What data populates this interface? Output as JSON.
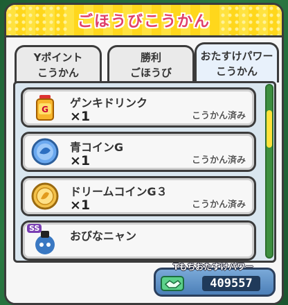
{
  "header": {
    "title": "ごほうびこうかん"
  },
  "tabs": [
    {
      "line1": "Yポイント",
      "line2": "こうかん"
    },
    {
      "line1": "勝利",
      "line2": "ごほうび"
    },
    {
      "line1": "おたすけパワー",
      "line2": "こうかん"
    }
  ],
  "items": [
    {
      "name": "ゲンキドリンク",
      "qty": "×1",
      "status": "こうかん済み",
      "icon": "drink-icon"
    },
    {
      "name": "青コインG",
      "qty": "×1",
      "status": "こうかん済み",
      "icon": "blue-coin-icon"
    },
    {
      "name": "ドリームコインG３",
      "qty": "×1",
      "status": "こうかん済み",
      "icon": "dream-coin-icon"
    },
    {
      "name": "おびなニャン",
      "qty": "",
      "status": "",
      "icon": "character-icon",
      "badge": "SS"
    }
  ],
  "points": {
    "label": "Tもちおたすけパワー",
    "value": "409557",
    "icon": "power-handshake-icon"
  },
  "colors": {
    "title": "#e0406a",
    "title_bar": "#ffd71c",
    "list_bg": "#d9e6ef",
    "scroll_track": "#3d8f3f",
    "scroll_thumb": "#ffe23a"
  }
}
